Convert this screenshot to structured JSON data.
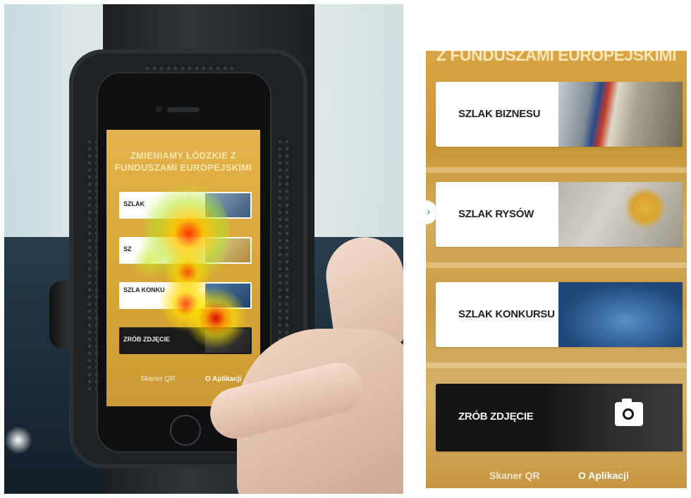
{
  "photo": {
    "screen_title": "ZMIENIAMY ŁÓDZKIE Z FUNDUSZAMI EUROPEJSKIMI",
    "mini_items": [
      "SZLAK",
      "SZ",
      "SZLA KONKU",
      "ZRÓB ZDJĘCIE"
    ],
    "footer_left": "Skaner QR",
    "footer_right": "O Aplikacji"
  },
  "app": {
    "header": "Z FUNDUSZAMI EUROPEJSKIMI",
    "back_icon": "chevron-right-icon",
    "back_glyph": "›",
    "routes": [
      {
        "label": "SZLAK BIZNESU"
      },
      {
        "label": "SZLAK RYSÓW"
      },
      {
        "label": "SZLAK KONKURSU"
      }
    ],
    "photo_button": {
      "label": "ZRÓB ZDJĘCIE",
      "icon": "camera-icon"
    },
    "footer": {
      "qr": "Skaner QR",
      "about": "O Aplikacji"
    },
    "colors": {
      "background": "#d0a043",
      "header_text": "#fbe7b6",
      "card": "#ffffff",
      "dark_card": "#141414",
      "accent_arrow": "#4a90c8"
    }
  }
}
